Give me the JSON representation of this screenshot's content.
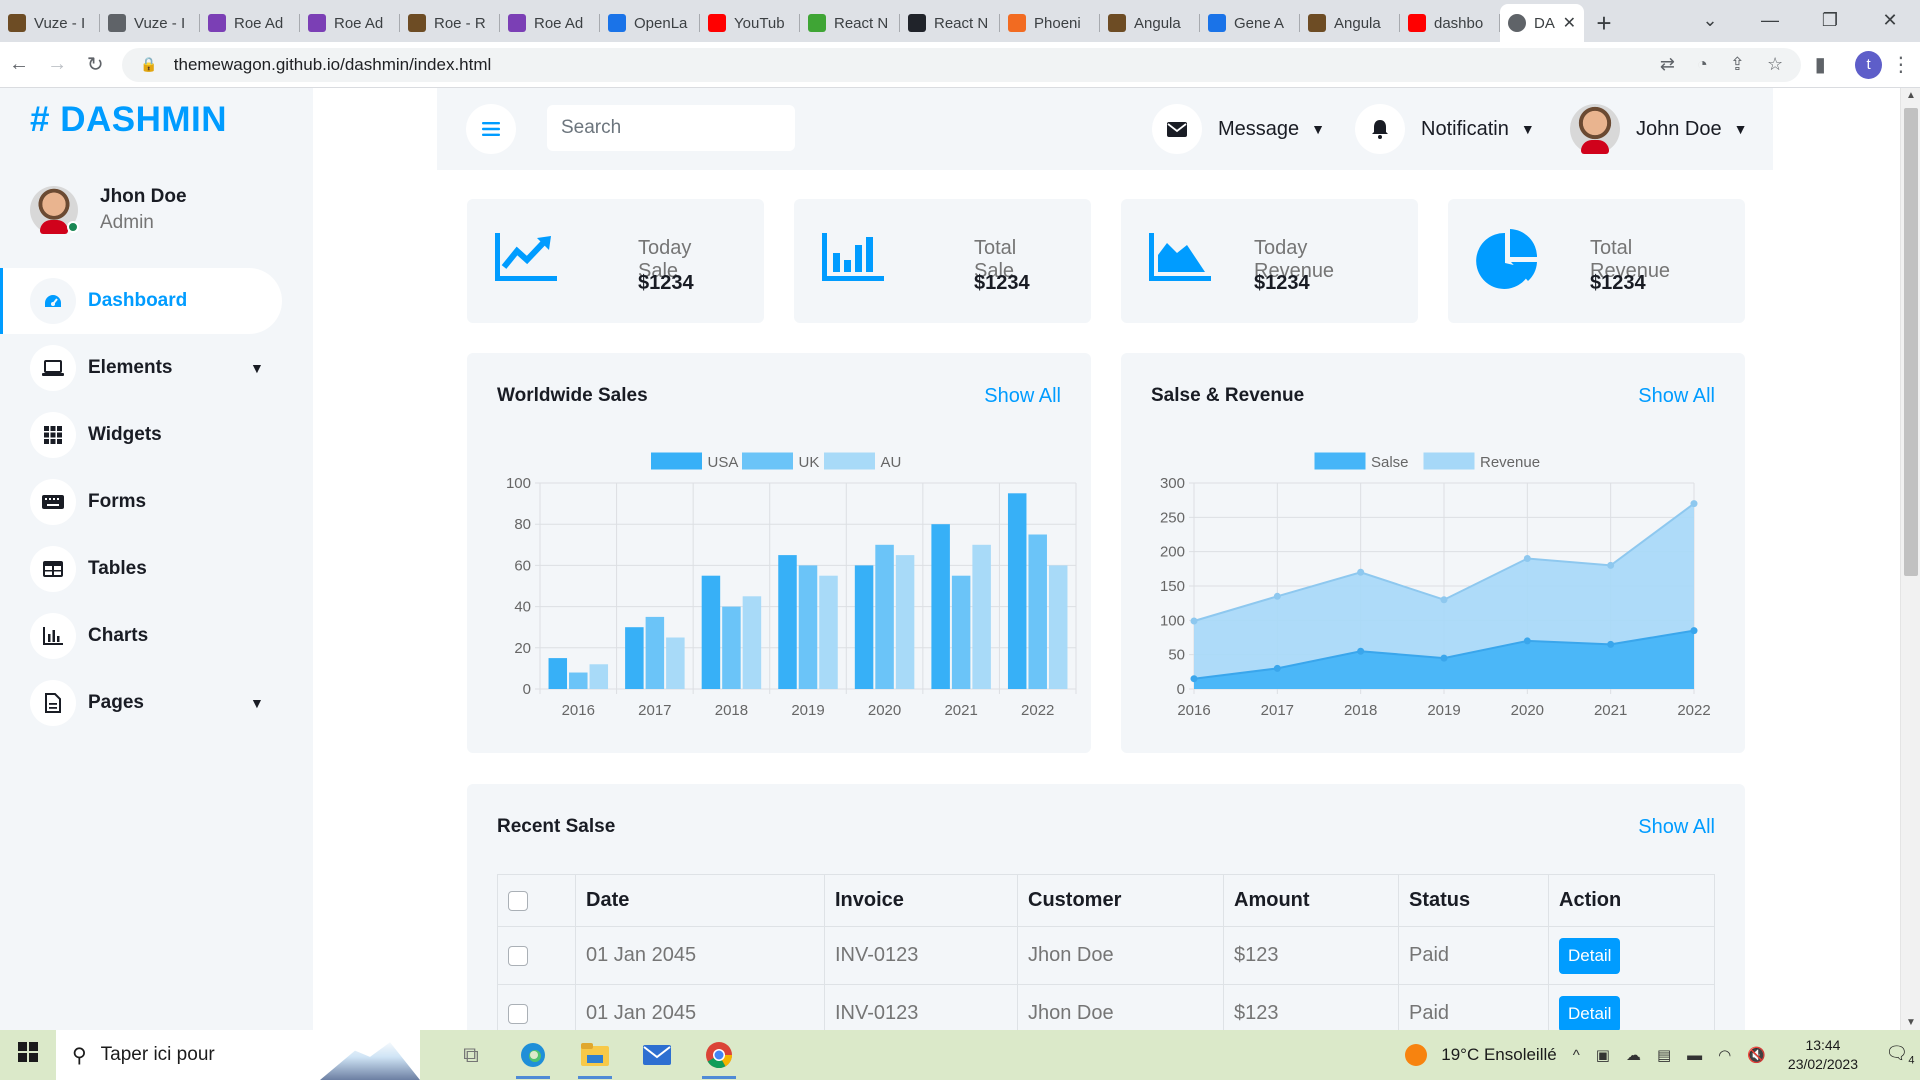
{
  "browser": {
    "tabs": [
      {
        "label": "Vuze - I",
        "color": "#6d4c24"
      },
      {
        "label": "Vuze - I",
        "color": "#5f6368"
      },
      {
        "label": "Roe Ad",
        "color": "#7b3fb5"
      },
      {
        "label": "Roe Ad",
        "color": "#7b3fb5"
      },
      {
        "label": "Roe - R",
        "color": "#6d4c24"
      },
      {
        "label": "Roe Ad",
        "color": "#7b3fb5"
      },
      {
        "label": "OpenLa",
        "color": "#1a73e8"
      },
      {
        "label": "YouTub",
        "color": "#ff0000"
      },
      {
        "label": "React N",
        "color": "#3fa535"
      },
      {
        "label": "React N",
        "color": "#20232a"
      },
      {
        "label": "Phoeni",
        "color": "#f26b21"
      },
      {
        "label": "Angula",
        "color": "#6d4c24"
      },
      {
        "label": "Gene A",
        "color": "#1a73e8"
      },
      {
        "label": "Angula",
        "color": "#6d4c24"
      },
      {
        "label": "dashbo",
        "color": "#ff0000"
      }
    ],
    "active_tab": "DA",
    "url": "themewagon.github.io/dashmin/index.html"
  },
  "sidebar": {
    "brand": "# DASHMIN",
    "user_name": "Jhon Doe",
    "user_role": "Admin",
    "items": [
      {
        "label": "Dashboard",
        "icon": "gauge-icon"
      },
      {
        "label": "Elements",
        "icon": "laptop-icon"
      },
      {
        "label": "Widgets",
        "icon": "grid-icon"
      },
      {
        "label": "Forms",
        "icon": "keyboard-icon"
      },
      {
        "label": "Tables",
        "icon": "table-icon"
      },
      {
        "label": "Charts",
        "icon": "chart-icon"
      },
      {
        "label": "Pages",
        "icon": "file-icon"
      }
    ]
  },
  "topbar": {
    "search_placeholder": "Search",
    "message_label": "Message",
    "notification_label": "Notificatin",
    "user_label": "John Doe"
  },
  "stats": [
    {
      "label": "Today Sale",
      "value": "$1234",
      "icon": "line-chart-icon"
    },
    {
      "label": "Total Sale",
      "value": "$1234",
      "icon": "bar-chart-icon"
    },
    {
      "label": "Today Revenue",
      "value": "$1234",
      "icon": "area-chart-icon"
    },
    {
      "label": "Total Revenue",
      "value": "$1234",
      "icon": "pie-chart-icon"
    }
  ],
  "panels": {
    "worldwide_title": "Worldwide Sales",
    "revenue_title": "Salse & Revenue",
    "recent_title": "Recent Salse",
    "show_all": "Show All"
  },
  "chart_data": [
    {
      "type": "bar",
      "title": "Worldwide Sales",
      "categories": [
        "2016",
        "2017",
        "2018",
        "2019",
        "2020",
        "2021",
        "2022"
      ],
      "series": [
        {
          "name": "USA",
          "values": [
            15,
            30,
            55,
            65,
            60,
            80,
            95
          ],
          "color": "#37b0f7"
        },
        {
          "name": "UK",
          "values": [
            8,
            35,
            40,
            60,
            70,
            55,
            75
          ],
          "color": "#6bc4f8"
        },
        {
          "name": "AU",
          "values": [
            12,
            25,
            45,
            55,
            65,
            70,
            60
          ],
          "color": "#a8daf8"
        }
      ],
      "ylim": [
        0,
        100
      ],
      "yticks": [
        0,
        20,
        40,
        60,
        80,
        100
      ],
      "legend": "top-center",
      "grid": true
    },
    {
      "type": "area",
      "title": "Salse & Revenue",
      "categories": [
        "2016",
        "2017",
        "2018",
        "2019",
        "2020",
        "2021",
        "2022"
      ],
      "series": [
        {
          "name": "Salse",
          "values": [
            15,
            30,
            55,
            45,
            70,
            65,
            85
          ],
          "color": "#46b5f8"
        },
        {
          "name": "Revenue",
          "values": [
            99,
            135,
            170,
            130,
            190,
            180,
            270
          ],
          "color": "#a6d8f8"
        }
      ],
      "ylim": [
        0,
        300
      ],
      "yticks": [
        0,
        50,
        100,
        150,
        200,
        250,
        300
      ],
      "legend": "top-center",
      "grid": true
    }
  ],
  "table": {
    "headers": [
      "Date",
      "Invoice",
      "Customer",
      "Amount",
      "Status",
      "Action"
    ],
    "rows": [
      [
        "01 Jan 2045",
        "INV-0123",
        "Jhon Doe",
        "$123",
        "Paid",
        "Detail"
      ],
      [
        "01 Jan 2045",
        "INV-0123",
        "Jhon Doe",
        "$123",
        "Paid",
        "Detail"
      ]
    ]
  },
  "taskbar": {
    "search_placeholder": "Taper ici pour",
    "weather": "19°C  Ensoleillé",
    "time": "13:44",
    "date": "23/02/2023",
    "notifications": "4"
  }
}
